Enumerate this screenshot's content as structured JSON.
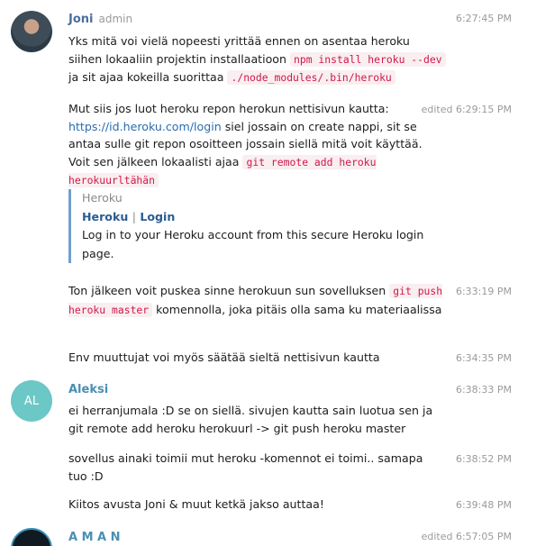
{
  "messages": [
    {
      "author": "Joni",
      "role": "admin",
      "time": "6:27:45 PM",
      "t1": "Yks mitä voi vielä nopeesti yrittää ennen on asentaa heroku siihen lokaaliin projektin installaatioon ",
      "c1": "npm install heroku --dev",
      "t2": " ja sit ajaa kokeilla suorittaa ",
      "c2": "./node_modules/.bin/heroku"
    },
    {
      "time": "edited 6:29:15 PM",
      "t1": "Mut siis jos luot heroku repon herokun nettisivun kautta: ",
      "link": "https://id.heroku.com/login",
      "t2": " siel jossain on create nappi, sit se antaa sulle git repon osoitteen jossain siellä mitä voit käyttää. Voit sen jälkeen lokaalisti ajaa ",
      "c1": "git remote add heroku herokuurltähän",
      "preview": {
        "site": "Heroku",
        "title_a": "Heroku",
        "sep": "|",
        "title_b": "Login",
        "description": "Log in to your Heroku account from this secure Heroku login page."
      }
    },
    {
      "time": "6:33:19 PM",
      "t1": "Ton jälkeen voit puskea sinne herokuun sun sovelluksen ",
      "c1": "git push heroku master",
      "t2": " komennolla, joka pitäis olla sama ku materiaalissa"
    },
    {
      "time": "6:34:35 PM",
      "t1": "Env muuttujat voi myös säätää sieltä nettisivun kautta"
    },
    {
      "author": "Aleksi",
      "avatar_initials": "AL",
      "time": "6:38:33 PM",
      "t1": "ei herranjumala :D se on siellä. sivujen kautta sain luotua sen ja git remote add heroku herokuurl -> git push heroku master"
    },
    {
      "time": "6:38:52 PM",
      "t1": "sovellus ainaki toimii mut heroku -komennot ei toimi.. samapa tuo :D"
    },
    {
      "time": "6:39:48 PM",
      "t1": "Kiitos avusta Joni & muut ketkä jakso auttaa!"
    },
    {
      "author": "A M A N",
      "time": "edited 6:57:05 PM"
    }
  ],
  "colors": {
    "name_joni": "#4a6f9c",
    "name_other": "#4a8fb3",
    "avatar_al": "#6cc7c7",
    "code": "#d0184a"
  }
}
